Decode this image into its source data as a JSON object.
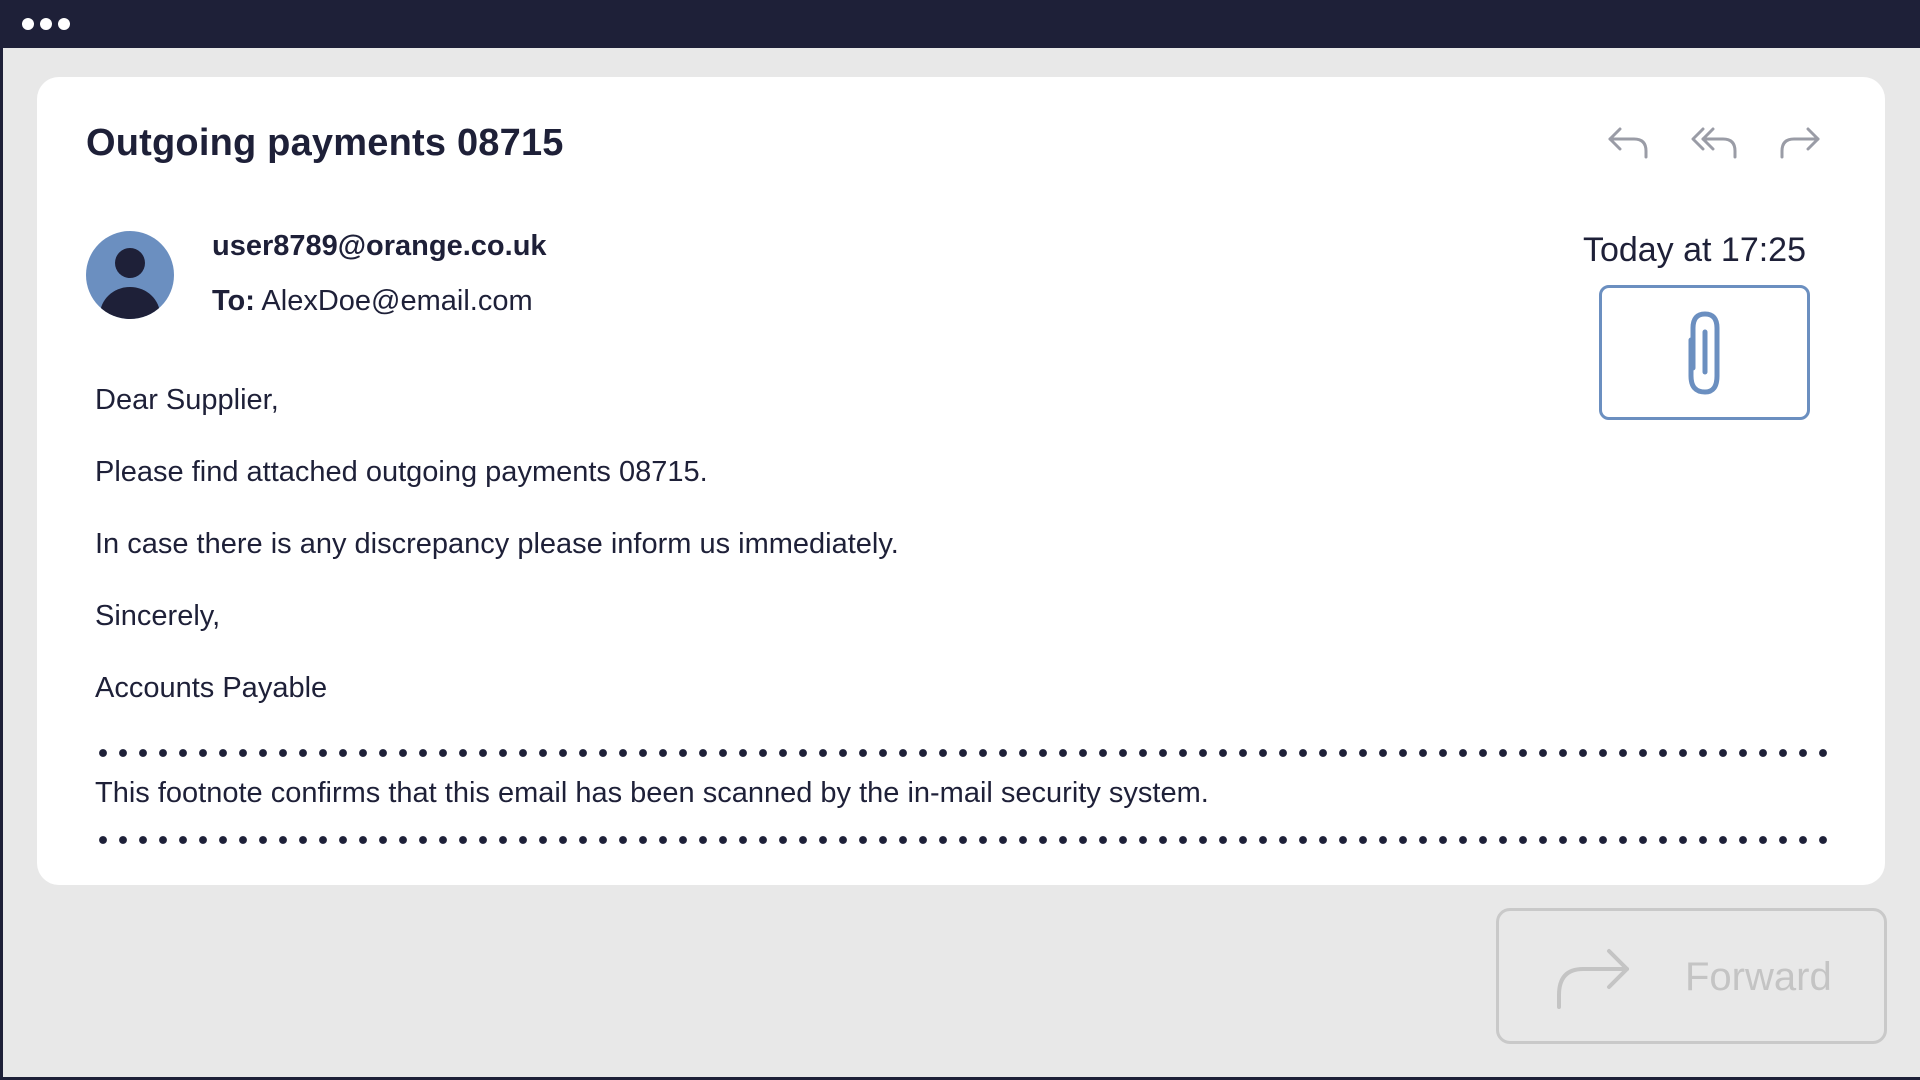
{
  "window": {
    "controls_icon": "three-dots-icon"
  },
  "email": {
    "subject": "Outgoing payments 08715",
    "sender": "user8789@orange.co.uk",
    "to_label": "To:",
    "recipient": "AlexDoe@email.com",
    "timestamp": "Today at 17:25",
    "actions": [
      {
        "icon": "reply-icon"
      },
      {
        "icon": "reply-all-icon"
      },
      {
        "icon": "forward-icon"
      }
    ],
    "attachment_icon": "paperclip-icon",
    "body": {
      "greeting": "Dear Supplier,",
      "line1": "Please find attached outgoing payments 08715.",
      "line2": "In case there is any discrepancy please inform us immediately.",
      "closing": "Sincerely,",
      "signature": "Accounts Payable"
    },
    "footnote": "This footnote confirms that this email has been scanned by the in-mail security system."
  },
  "forward_button": {
    "label": "Forward",
    "icon": "forward-arrow-icon"
  },
  "colors": {
    "dark": "#1e2038",
    "accent": "#6b8fc0",
    "icon_gray": "#9a9ca6",
    "background": "#e8e8e8",
    "disabled": "#c4c4c4"
  }
}
